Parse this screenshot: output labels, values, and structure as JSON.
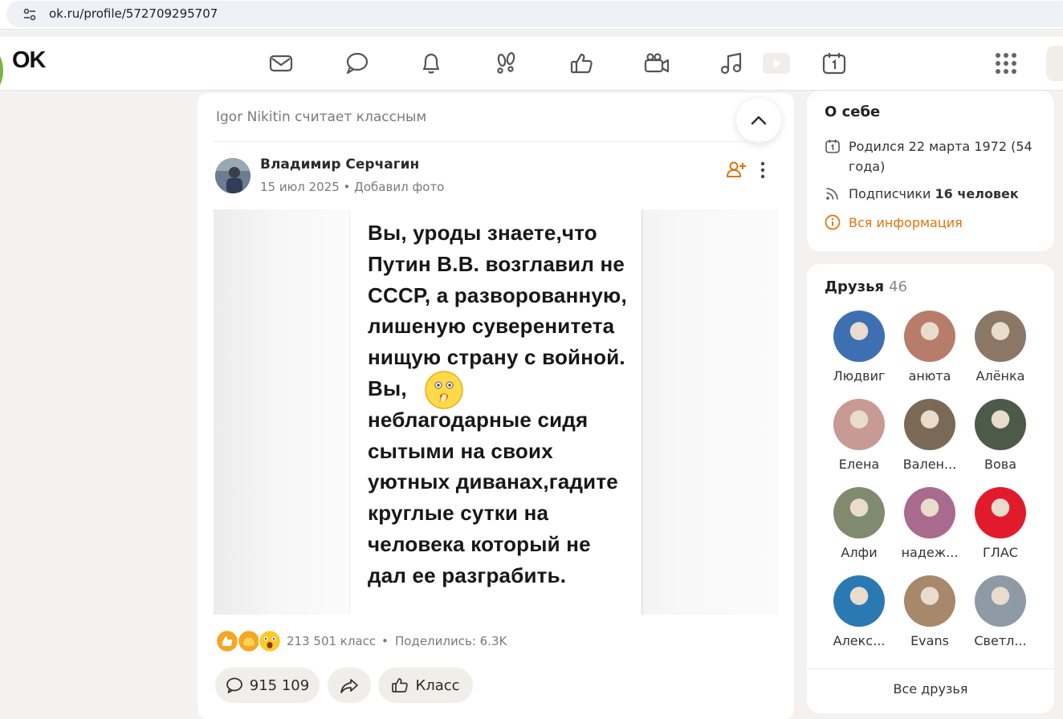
{
  "browser": {
    "url": "ok.ru/profile/572709295707"
  },
  "topnav": {
    "logo": "OK",
    "icons": [
      "envelope-icon",
      "chat-icon",
      "bell-icon",
      "footprints-icon",
      "thumbs-up-icon",
      "video-camera-icon",
      "music-note-icon",
      "play-badge-icon",
      "calendar-icon",
      "apps-grid-icon"
    ]
  },
  "feed": {
    "liked_note": "Igor Nikitin считает классным",
    "post": {
      "author": "Владимир Серчагин",
      "date": "15 июл 2025",
      "meta_sep": " • ",
      "action": "Добавил фото",
      "image_text": "Вы, уроды знаете,что\nПутин В.В. возглавил не\nСССР, а разворованную,\nлишеную суверенитета\nнищую страну с войной.\nВы,\nнеблагодарные сидя\nсытыми на своих\nуютных диванах,гадите\nкруглые сутки на\nчеловека который не\nдал ее разграбить.",
      "reactions_count": "213 501 класс",
      "reactions_sep": "•",
      "shares": "Поделились: 6.3K",
      "comments_count": "915 109",
      "like_label": "Класс"
    }
  },
  "about": {
    "title": "О себе",
    "birth": "Родился 22 марта 1972 (54 года)",
    "subscribers_prefix": "Подписчики ",
    "subscribers_value": "16 человек",
    "all_info": "Вся информация",
    "accent": "#e3720b"
  },
  "friends": {
    "title": "Друзья",
    "count": "46",
    "list": [
      {
        "name": "Людвиг",
        "color": "#3f6fb3"
      },
      {
        "name": "анюта",
        "color": "#b77d6a"
      },
      {
        "name": "Алёнка",
        "color": "#8a7766"
      },
      {
        "name": "Елена",
        "color": "#c79a93"
      },
      {
        "name": "Вален...",
        "color": "#7a6a55"
      },
      {
        "name": "Вова",
        "color": "#4d5a4a"
      },
      {
        "name": "Алфи",
        "color": "#7f8a6e"
      },
      {
        "name": "надеж...",
        "color": "#a96b8d"
      },
      {
        "name": "ГЛАС",
        "color": "#e11b2b"
      },
      {
        "name": "Алекс...",
        "color": "#2a79b3"
      },
      {
        "name": "Evans",
        "color": "#a8886a"
      },
      {
        "name": "Светл...",
        "color": "#8e9aa6"
      }
    ],
    "all_label": "Все друзья"
  }
}
